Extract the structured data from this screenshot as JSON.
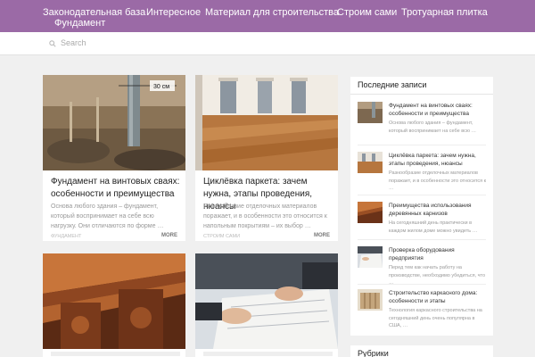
{
  "nav": {
    "items": [
      "Законодательная база",
      "Интересное",
      "Материал для строительства",
      "Строим сами",
      "Тротуарная плитка",
      "Фундамент"
    ]
  },
  "search": {
    "placeholder": "Search"
  },
  "cards": [
    {
      "image_label": "30 см",
      "title": "Фундамент на винтовых сваях: особенности и преимущества",
      "excerpt": "Основа любого здания – фундамент, который воспринимает на себе всю нагрузку. Они отличаются по форме …",
      "category": "ФУНДАМЕНТ",
      "more": "MORE"
    },
    {
      "title": "Циклёвка паркета: зачем нужна, этапы проведения, нюансы",
      "excerpt": "Разнообразие отделочных материалов поражает, и в особенности это относится к напольным покрытиям – их выбор …",
      "category": "СТРОИМ САМИ",
      "more": "MORE"
    }
  ],
  "sidebar": {
    "recent_title": "Последние записи",
    "posts": [
      {
        "title": "Фундамент на винтовых сваях: особенности и преимущества",
        "excerpt": "Основа любого здания – фундамент, который воспринимает на себе всю …"
      },
      {
        "title": "Циклёвка паркета: зачем нужна, этапы проведения, нюансы",
        "excerpt": "Разнообразие отделочных материалов поражает, и в особенности это относится к …"
      },
      {
        "title": "Преимущества использования деревянных карнизов",
        "excerpt": "На сегодняшний день практически в каждом жилом доме можно увидеть …"
      },
      {
        "title": "Проверка оборудования предприятия",
        "excerpt": "Перед тем как начать работу на производстве, необходимо убедиться, что …"
      },
      {
        "title": "Строительство каркасного дома: особенности и этапы",
        "excerpt": "Технология каркасного строительства на сегодняшний день очень популярна в США, …"
      }
    ],
    "rubrics_title": "Рубрики"
  },
  "colors": {
    "nav_bg": "#9b6aa6",
    "page_bg": "#f0f0f0"
  }
}
